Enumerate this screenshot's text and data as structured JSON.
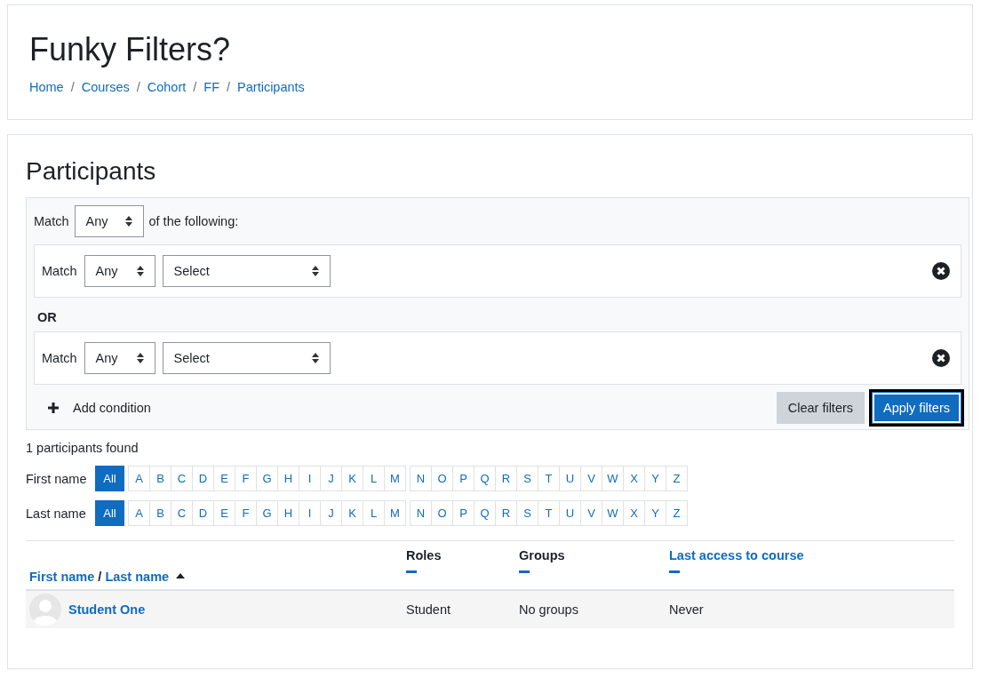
{
  "header": {
    "title": "Funky Filters?",
    "breadcrumbs": [
      "Home",
      "Courses",
      "Cohort",
      "FF",
      "Participants"
    ],
    "separator": "/"
  },
  "participants": {
    "heading": "Participants",
    "filter": {
      "match_label": "Match",
      "match_value": "Any",
      "match_suffix": "of the following:",
      "joiner": "OR",
      "conditions": [
        {
          "match_label": "Match",
          "match_value": "Any",
          "type_value": "Select"
        },
        {
          "match_label": "Match",
          "match_value": "Any",
          "type_value": "Select"
        }
      ],
      "add_condition": "Add condition",
      "clear_button": "Clear filters",
      "apply_button": "Apply filters"
    },
    "found": "1 participants found",
    "initials_bars": [
      {
        "label": "First name",
        "all": {
          "label": "All",
          "selected": true
        },
        "groups": [
          [
            {
              "label": "A",
              "selected": false
            },
            {
              "label": "B",
              "selected": false
            },
            {
              "label": "C",
              "selected": false
            },
            {
              "label": "D",
              "selected": false
            },
            {
              "label": "E",
              "selected": false
            },
            {
              "label": "F",
              "selected": false
            },
            {
              "label": "G",
              "selected": false
            },
            {
              "label": "H",
              "selected": false
            },
            {
              "label": "I",
              "selected": false
            },
            {
              "label": "J",
              "selected": false
            },
            {
              "label": "K",
              "selected": false
            },
            {
              "label": "L",
              "selected": false
            },
            {
              "label": "M",
              "selected": false
            }
          ],
          [
            {
              "label": "N",
              "selected": false
            },
            {
              "label": "O",
              "selected": false
            },
            {
              "label": "P",
              "selected": false
            },
            {
              "label": "Q",
              "selected": false
            },
            {
              "label": "R",
              "selected": false
            },
            {
              "label": "S",
              "selected": false
            },
            {
              "label": "T",
              "selected": false
            },
            {
              "label": "U",
              "selected": false
            },
            {
              "label": "V",
              "selected": false
            },
            {
              "label": "W",
              "selected": false
            },
            {
              "label": "X",
              "selected": false
            },
            {
              "label": "Y",
              "selected": false
            },
            {
              "label": "Z",
              "selected": false
            }
          ]
        ]
      },
      {
        "label": "Last name",
        "all": {
          "label": "All",
          "selected": true
        },
        "groups": [
          [
            {
              "label": "A",
              "selected": false
            },
            {
              "label": "B",
              "selected": false
            },
            {
              "label": "C",
              "selected": false
            },
            {
              "label": "D",
              "selected": false
            },
            {
              "label": "E",
              "selected": false
            },
            {
              "label": "F",
              "selected": false
            },
            {
              "label": "G",
              "selected": false
            },
            {
              "label": "H",
              "selected": false
            },
            {
              "label": "I",
              "selected": false
            },
            {
              "label": "J",
              "selected": false
            },
            {
              "label": "K",
              "selected": false
            },
            {
              "label": "L",
              "selected": false
            },
            {
              "label": "M",
              "selected": false
            }
          ],
          [
            {
              "label": "N",
              "selected": false
            },
            {
              "label": "O",
              "selected": false
            },
            {
              "label": "P",
              "selected": false
            },
            {
              "label": "Q",
              "selected": false
            },
            {
              "label": "R",
              "selected": false
            },
            {
              "label": "S",
              "selected": false
            },
            {
              "label": "T",
              "selected": false
            },
            {
              "label": "U",
              "selected": false
            },
            {
              "label": "V",
              "selected": false
            },
            {
              "label": "W",
              "selected": false
            },
            {
              "label": "X",
              "selected": false
            },
            {
              "label": "Y",
              "selected": false
            },
            {
              "label": "Z",
              "selected": false
            }
          ]
        ]
      }
    ],
    "table": {
      "name_column": {
        "first": "First name",
        "separator": "/",
        "last": "Last name"
      },
      "columns": [
        {
          "label": "Roles",
          "link": false
        },
        {
          "label": "Groups",
          "link": false
        },
        {
          "label": "Last access to course",
          "link": true
        }
      ],
      "rows": [
        {
          "name": "Student One",
          "cells": [
            "Student",
            "No groups",
            "Never"
          ]
        }
      ]
    }
  }
}
